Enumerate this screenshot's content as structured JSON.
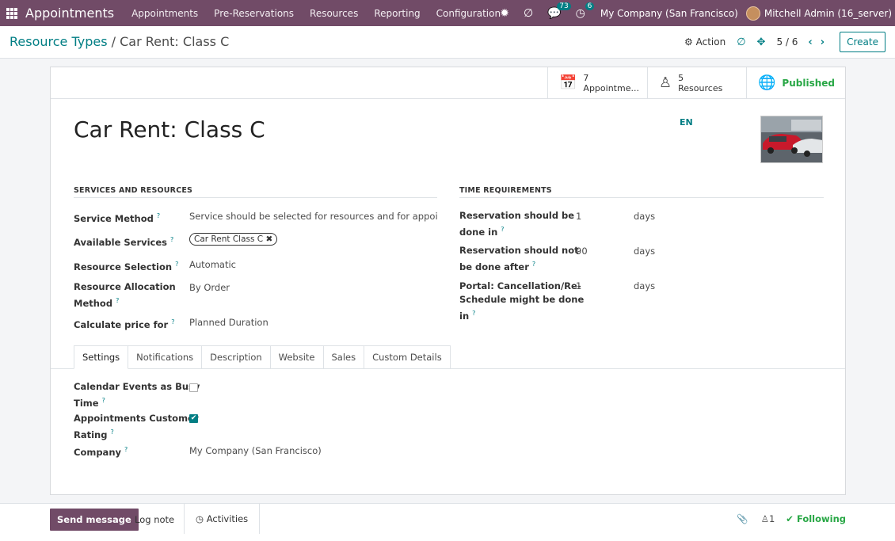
{
  "nav": {
    "app_title": "Appointments",
    "menu": [
      "Appointments",
      "Pre-Reservations",
      "Resources",
      "Reporting",
      "Configuration"
    ],
    "messages_count": "73",
    "activities_count": "6",
    "company": "My Company (San Francisco)",
    "user": "Mitchell Admin (16_server)"
  },
  "control_panel": {
    "breadcrumb_parent": "Resource Types",
    "breadcrumb_sep": "/",
    "breadcrumb_current": "Car Rent: Class C",
    "action_label": "Action",
    "pager": "5 / 6",
    "create_label": "Create"
  },
  "stats": {
    "appointments_count": "7",
    "appointments_label": "Appointme...",
    "resources_count": "5",
    "resources_label": "Resources",
    "published_label": "Published"
  },
  "record": {
    "title": "Car Rent: Class C",
    "lang": "EN"
  },
  "services": {
    "section_title": "SERVICES AND RESOURCES",
    "service_method_label": "Service Method",
    "service_method_value": "Service should be selected for resources and for appointmer",
    "available_services_label": "Available Services",
    "available_services_tag": "Car Rent Class C",
    "resource_selection_label": "Resource Selection",
    "resource_selection_value": "Automatic",
    "allocation_label_1": "Resource Allocation",
    "allocation_label_2": "Method",
    "allocation_value": "By Order",
    "price_label": "Calculate price for",
    "price_value": "Planned Duration"
  },
  "time": {
    "section_title": "TIME REQUIREMENTS",
    "r1_label_1": "Reservation should be",
    "r1_label_2": "done in",
    "r1_value": "1",
    "r1_unit": "days",
    "r2_label_1": "Reservation should not",
    "r2_label_2": "be done after",
    "r2_value": "90",
    "r2_unit": "days",
    "r3_label_1": "Portal: Cancellation/Re-",
    "r3_label_2": "Schedule might be done",
    "r3_label_3": "in",
    "r3_value": "1",
    "r3_unit": "days"
  },
  "tabs": [
    "Settings",
    "Notifications",
    "Description",
    "Website",
    "Sales",
    "Custom Details"
  ],
  "settings": {
    "busy_label_1": "Calendar Events as Busy",
    "busy_label_2": "Time",
    "busy_checked": false,
    "rating_label_1": "Appointments Customer",
    "rating_label_2": "Rating",
    "rating_checked": true,
    "company_label": "Company",
    "company_value": "My Company (San Francisco)"
  },
  "chatter": {
    "send_message": "Send message",
    "log_note": "Log note",
    "activities": "Activities",
    "followers_count": "1",
    "following": "Following"
  },
  "colors": {
    "brand": "#714b67",
    "accent": "#017e84",
    "success": "#28a745"
  }
}
